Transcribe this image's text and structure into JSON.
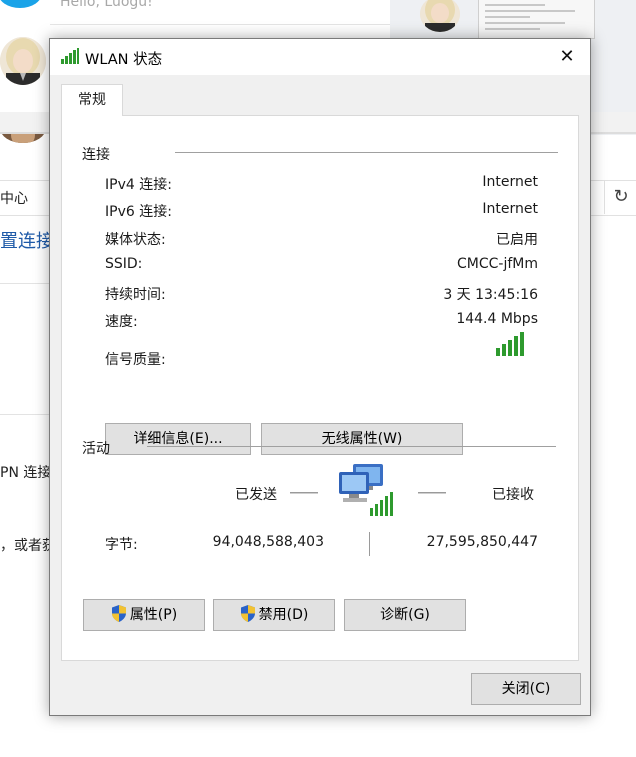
{
  "background": {
    "greeting": "Hello, Luogu!",
    "breadcrumb": "中心",
    "link_text": "置连接",
    "text_vpn": "PN 连接",
    "text_or": "，或者获",
    "refresh_glyph": "↻"
  },
  "dialog": {
    "title": "WLAN 状态",
    "close_glyph": "✕",
    "tab": "常规",
    "connection": {
      "group": "连接",
      "rows": [
        {
          "label": "IPv4 连接:",
          "value": "Internet"
        },
        {
          "label": "IPv6 连接:",
          "value": "Internet"
        },
        {
          "label": "媒体状态:",
          "value": "已启用"
        },
        {
          "label": "SSID:",
          "value": "CMCC-jfMm"
        },
        {
          "label": "持续时间:",
          "value": "3 天 13:45:16"
        },
        {
          "label": "速度:",
          "value": "144.4 Mbps"
        }
      ],
      "signal_label": "信号质量:",
      "signal_bars": 5,
      "details_button": "详细信息(E)...",
      "wireless_props_button": "无线属性(W)"
    },
    "activity": {
      "group": "活动",
      "sent_label": "已发送",
      "received_label": "已接收",
      "bytes_label": "字节:",
      "bytes_sent": "94,048,588,403",
      "bytes_received": "27,595,850,447"
    },
    "buttons": {
      "properties": "属性(P)",
      "disable": "禁用(D)",
      "diagnose": "诊断(G)",
      "close": "关闭(C)"
    }
  },
  "colors": {
    "signal_green": "#2e9a2e",
    "shield_blue": "#2a63c9",
    "shield_yellow": "#f2c232",
    "link_blue": "#1e5aa8"
  },
  "icons": [
    "wifi-signal-icon",
    "network-computers-icon",
    "uac-shield-icon",
    "close-icon",
    "refresh-icon"
  ]
}
